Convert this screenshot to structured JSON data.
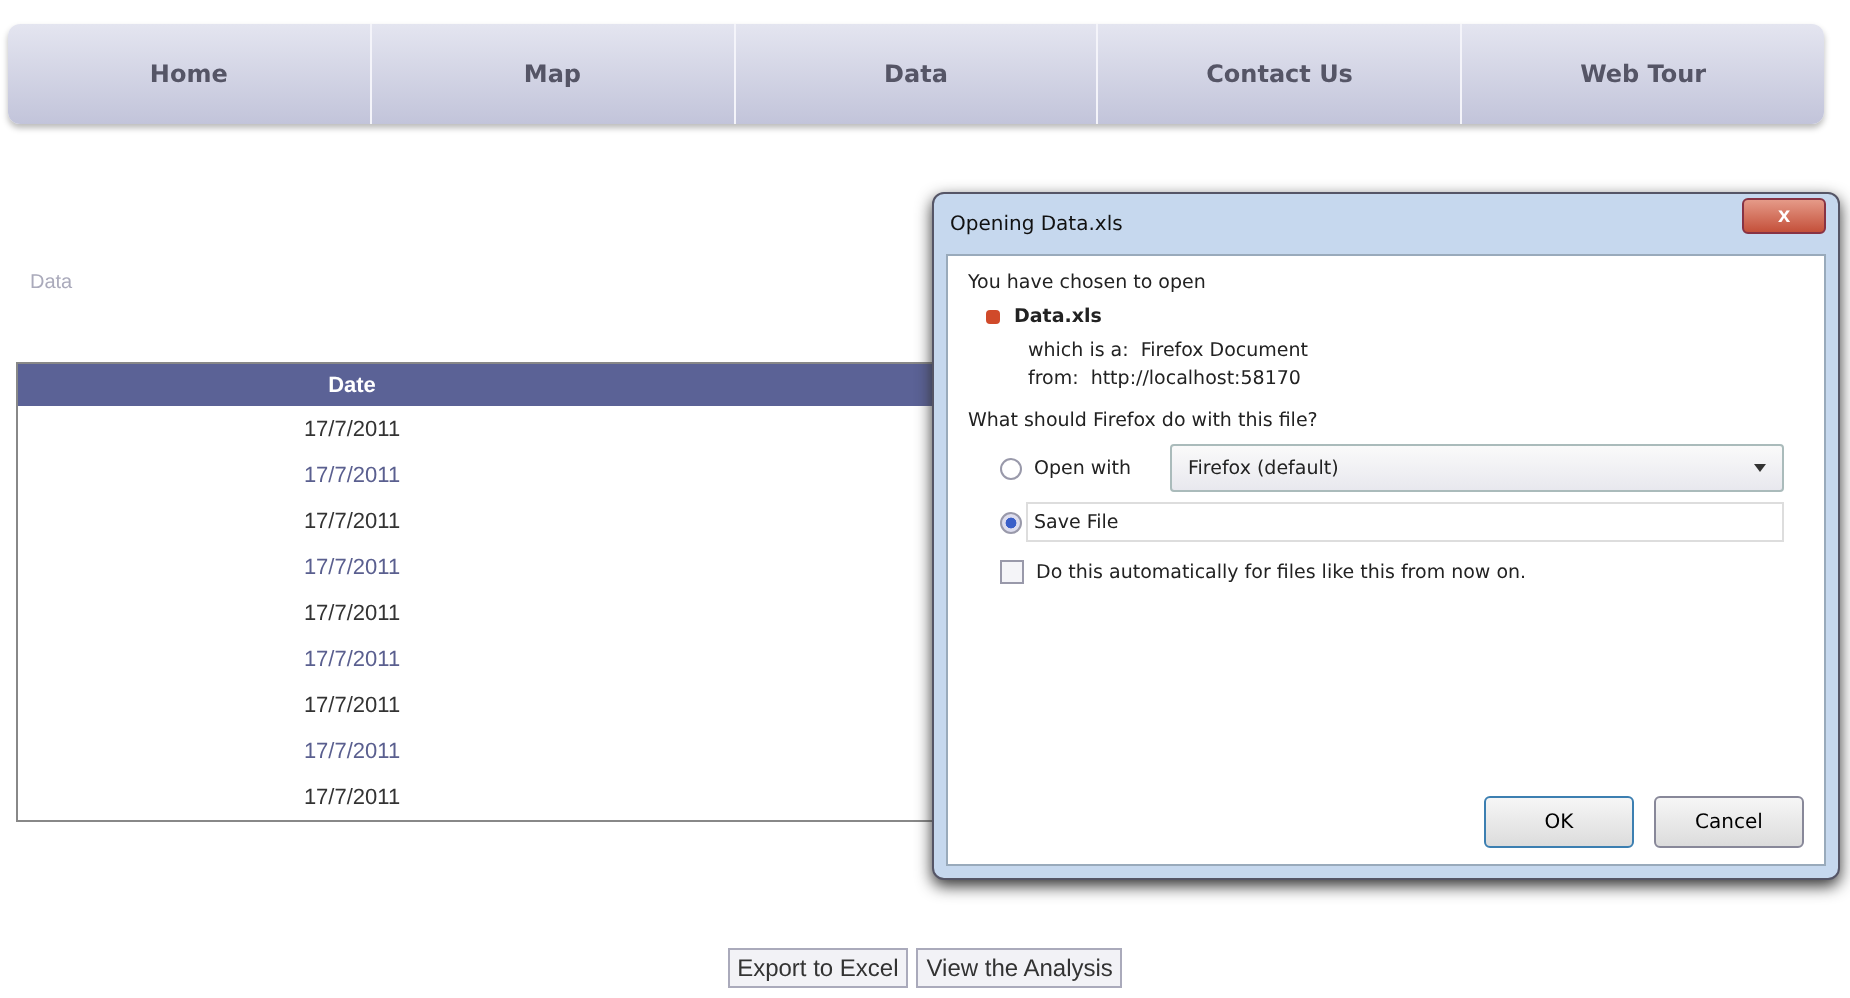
{
  "nav": [
    {
      "label": "Home",
      "selected": false
    },
    {
      "label": "Map",
      "selected": false
    },
    {
      "label": "Data",
      "selected": false
    },
    {
      "label": "Contact Us",
      "selected": false
    },
    {
      "label": "Web Tour",
      "selected": false
    }
  ],
  "page_title": "Data",
  "table": {
    "columns": [
      "Date"
    ],
    "rows": [
      [
        "17/7/2011"
      ],
      [
        "17/7/2011"
      ],
      [
        "17/7/2011"
      ],
      [
        "17/7/2011"
      ],
      [
        "17/7/2011"
      ],
      [
        "17/7/2011"
      ],
      [
        "17/7/2011"
      ],
      [
        "17/7/2011"
      ],
      [
        "17/7/2011"
      ]
    ]
  },
  "dialog": {
    "title": "Opening Data.xls",
    "close": "x",
    "intro": "You have chosen to open",
    "file_name": "Data.xls",
    "type_label": "which is a:",
    "type_value": "Firefox Document",
    "from_label": "from:",
    "from_value": "http://localhost:58170",
    "question": "What should Firefox do with this file?",
    "options": [
      {
        "kind": "open",
        "label": "Open with",
        "selected": false,
        "app": "Firefox (default)"
      },
      {
        "kind": "save",
        "label": "Save File",
        "selected": true
      }
    ],
    "auto": {
      "label": "Do this automatically for files like this from now on.",
      "checked": false
    },
    "buttons": [
      "OK",
      "Cancel"
    ]
  },
  "buttons": [
    "Export to Excel",
    "View the Analysis"
  ]
}
